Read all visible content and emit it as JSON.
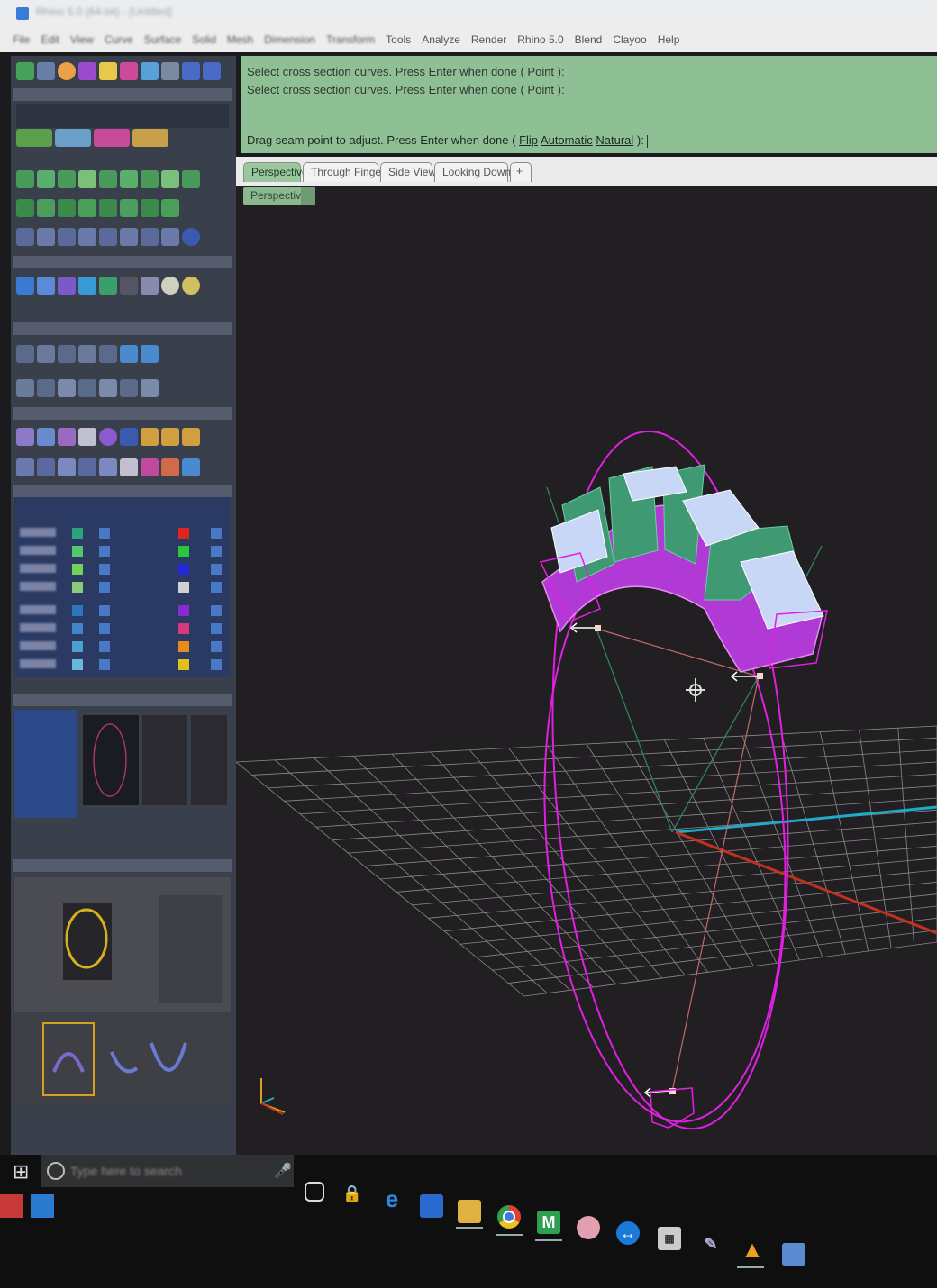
{
  "app": {
    "title": "Rhino 5.0 (64-bit) - [Untitled]"
  },
  "menu": [
    "File",
    "Edit",
    "View",
    "Curve",
    "Surface",
    "Solid",
    "Mesh",
    "Dimension",
    "Transform",
    "Tools",
    "Analyze",
    "Render",
    "Rhino 5.0",
    "Blend",
    "Clayoo",
    "Help"
  ],
  "command": {
    "history": [
      "Select cross section curves. Press Enter when done ( Point ):",
      "Select cross section curves. Press Enter when done ( Point ):"
    ],
    "prompt": "Drag seam point to adjust. Press Enter when done (",
    "options": [
      "Flip",
      "Automatic",
      "Natural"
    ],
    "prompt_end": "):"
  },
  "viewport_tabs": [
    "Perspective",
    "Through Finger",
    "Side View",
    "Looking Down"
  ],
  "add_tab_label": "+",
  "viewport_label": "Perspective",
  "colors": {
    "command_bg": "#8fbf94",
    "active_tab": "#9ac79e",
    "viewport_bg": "#221f22",
    "curve_magenta": "#e020e0",
    "solid_purple": "#b13ad6",
    "solid_green": "#3f9a73",
    "mesh_light": "#c7d7f5",
    "axis_red": "#c2301e",
    "axis_cyan": "#1faac9",
    "grid": "#8a8a8a"
  },
  "left_panel": {
    "layer_swatches_left": [
      "#2ba37c",
      "#53c86a",
      "#6fd35a",
      "#8acb7a",
      "#2a76b8",
      "#3d86c9",
      "#4ea0d4",
      "#6ab7dc"
    ],
    "layer_swatches_right": [
      "#e02424",
      "#2cc63a",
      "#2328d8",
      "#d0d0d0",
      "#8a2ad0",
      "#d63a7a",
      "#e98a1c",
      "#e0c21c"
    ]
  },
  "taskbar": {
    "search_placeholder": "Type here to search",
    "icons": [
      "task-view-icon",
      "lock-icon",
      "edge-icon",
      "remote-desktop-icon",
      "file-explorer-icon",
      "chrome-icon",
      "matrix-icon",
      "brain-icon",
      "teamviewer-icon",
      "calculator-icon",
      "tool-icon",
      "app-triangle-icon",
      "app-window-icon"
    ]
  }
}
